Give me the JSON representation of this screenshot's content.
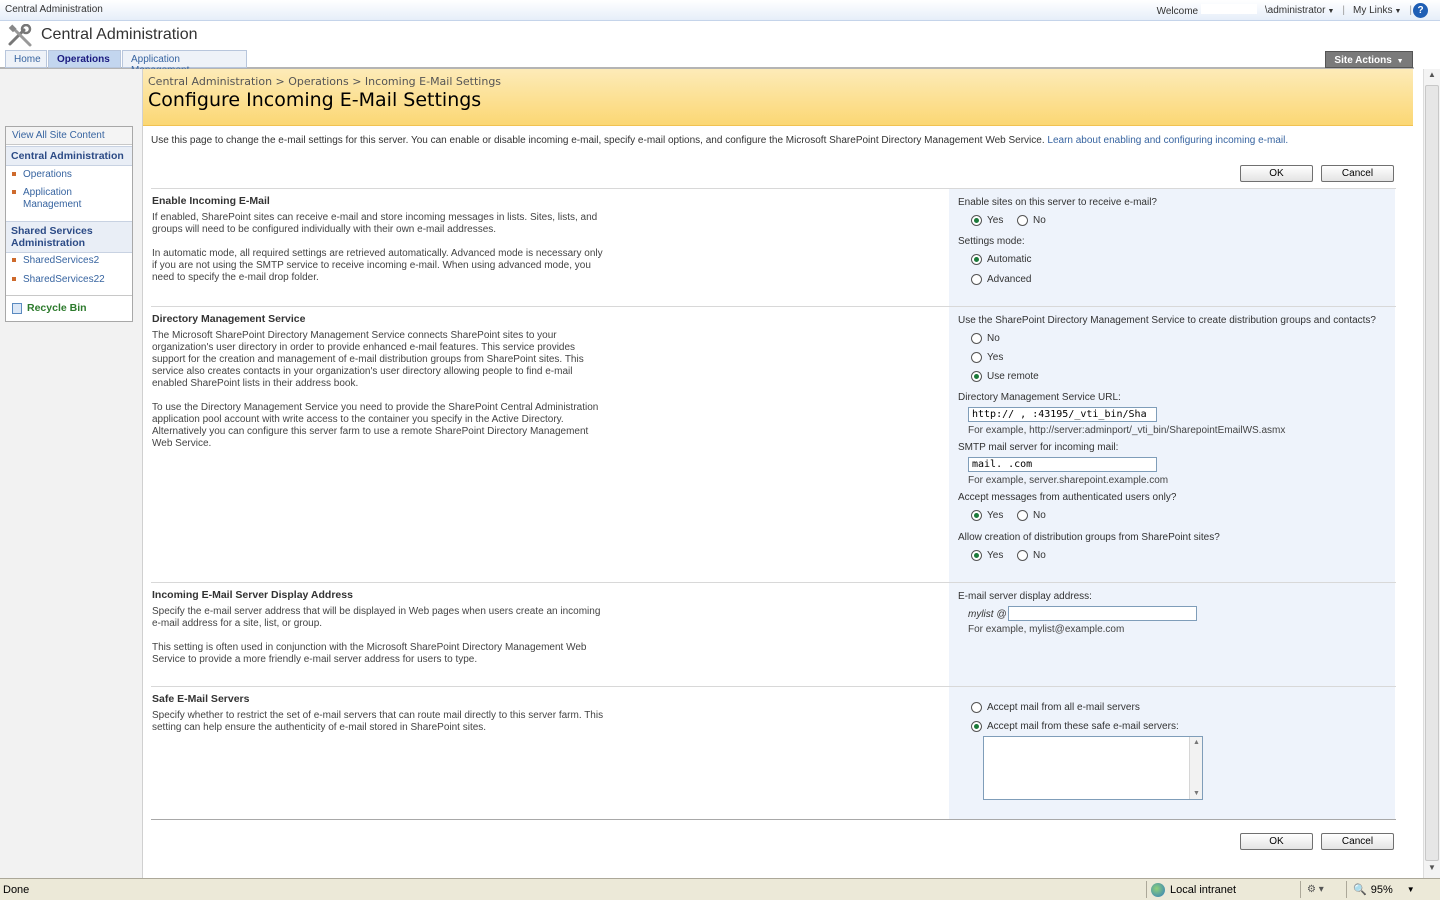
{
  "topbar": {
    "site_name": "Central Administration",
    "welcome": "Welcome",
    "user": "\\administrator",
    "my_links": "My Links",
    "help_glyph": "?"
  },
  "header": {
    "title": "Central Administration"
  },
  "tabs": [
    {
      "label": "Home"
    },
    {
      "label": "Operations",
      "active": true
    },
    {
      "label": "Application Management"
    }
  ],
  "site_actions": "Site Actions",
  "breadcrumb": "Central Administration > Operations > Incoming E-Mail Settings",
  "page_title": "Configure Incoming E-Mail Settings",
  "nav": {
    "view_all": "View All Site Content",
    "group1": "Central Administration",
    "group1_items": [
      "Operations",
      "Application Management"
    ],
    "group2": "Shared Services Administration",
    "group2_items": [
      "SharedServices2",
      "SharedServices22"
    ],
    "recycle_bin": "Recycle Bin"
  },
  "intro": {
    "text": "Use this page to change the e-mail settings for this server. You can enable or disable incoming e-mail, specify e-mail options, and configure the Microsoft SharePoint Directory Management Web Service.",
    "link": "Learn about enabling and configuring incoming e-mail."
  },
  "buttons": {
    "ok": "OK",
    "cancel": "Cancel"
  },
  "sections": {
    "enable": {
      "title": "Enable Incoming E-Mail",
      "p1": "If enabled, SharePoint sites can receive e-mail and store incoming messages in lists. Sites, lists, and groups will need to be configured individually with their own e-mail addresses.",
      "p2": "In automatic mode, all required settings are retrieved automatically. Advanced mode is necessary only if you are not using the SMTP service to receive incoming e-mail. When using advanced mode, you need to specify the e-mail drop folder.",
      "q1": "Enable sites on this server to receive e-mail?",
      "yes": "Yes",
      "no": "No",
      "q2": "Settings mode:",
      "automatic": "Automatic",
      "advanced": "Advanced"
    },
    "directory": {
      "title": "Directory Management Service",
      "p1": "The Microsoft SharePoint Directory Management Service connects SharePoint sites to your organization's user directory in order to provide enhanced e-mail features. This service provides support for the creation and management of e-mail distribution groups from SharePoint sites. This service also creates contacts in your organization's user directory allowing people to find e-mail enabled SharePoint lists in their address book.",
      "p2": "To use the Directory Management Service you need to provide the SharePoint Central Administration application pool account with write access to the container you specify in the Active Directory. Alternatively you can configure this server farm to use a remote SharePoint Directory Management Web Service.",
      "q1": "Use the SharePoint Directory Management Service to create distribution groups and contacts?",
      "no": "No",
      "yes": "Yes",
      "use_remote": "Use remote",
      "url_label": "Directory Management Service URL:",
      "url_value": "http://   ,     :43195/_vti_bin/Sha",
      "url_hint": "For example, http://server:adminport/_vti_bin/SharepointEmailWS.asmx",
      "smtp_label": "SMTP mail server for incoming mail:",
      "smtp_value": "mail.                    .com",
      "smtp_hint": "For example, server.sharepoint.example.com",
      "q_auth": "Accept messages from authenticated users only?",
      "q_groups": "Allow creation of distribution groups from SharePoint sites?"
    },
    "display": {
      "title": "Incoming E-Mail Server Display Address",
      "p1": "Specify the e-mail server address that will be displayed in Web pages when users create an incoming e-mail address for a site, list, or group.",
      "p2": "This setting is often used in conjunction with the Microsoft SharePoint Directory Management Web Service to provide a more friendly e-mail server address for users to type.",
      "label": "E-mail server display address:",
      "prefix": "mylist @",
      "value": "",
      "hint": "For example, mylist@example.com"
    },
    "safe": {
      "title": "Safe E-Mail Servers",
      "p1": "Specify whether to restrict the set of e-mail servers that can route mail directly to this server farm. This setting can help ensure the authenticity of e-mail stored in SharePoint sites.",
      "all": "Accept mail from all e-mail servers",
      "these": "Accept mail from these safe e-mail servers:"
    }
  },
  "statusbar": {
    "status": "Done",
    "zone": "Local intranet",
    "zoom": "95%"
  }
}
